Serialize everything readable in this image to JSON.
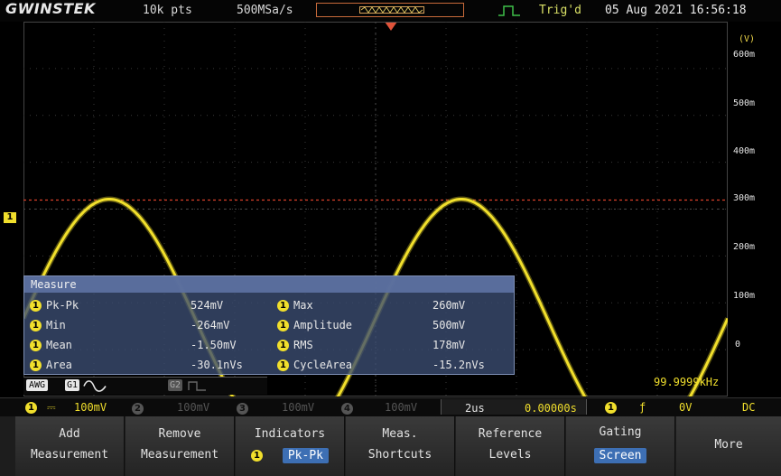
{
  "topbar": {
    "logo": "GWINSTEK",
    "record_length": "10k pts",
    "sample_rate": "500MSa/s",
    "trigger_status": "Trig'd",
    "datetime": "05 Aug 2021 16:56:18"
  },
  "right_scale": {
    "unit": "(V)",
    "labels": [
      "600m",
      "500m",
      "400m",
      "300m",
      "200m",
      "100m",
      "0"
    ]
  },
  "markers": {
    "channel": "1"
  },
  "measure": {
    "title": "Measure",
    "rows": [
      {
        "name": "Pk-Pk",
        "value": "524mV",
        "name2": "Max",
        "value2": "260mV"
      },
      {
        "name": "Min",
        "value": "-264mV",
        "name2": "Amplitude",
        "value2": "500mV"
      },
      {
        "name": "Mean",
        "value": "-1.50mV",
        "name2": "RMS",
        "value2": "178mV"
      },
      {
        "name": "Area",
        "value": "-30.1nVs",
        "name2": "CycleArea",
        "value2": "-15.2nVs"
      }
    ]
  },
  "frequency": "99.9999kHz",
  "source_bar": {
    "awg": "AWG",
    "g1": "G1",
    "g2": "G2"
  },
  "channel_bar": {
    "ch1": "1",
    "ch1_scale": "100mV",
    "ch2": "2",
    "ch2_scale": "100mV",
    "ch3": "3",
    "ch3_scale": "100mV",
    "ch4": "4",
    "ch4_scale": "100mV",
    "timebase": "2us",
    "delay": "0.00000s",
    "trig_source": "1",
    "trig_level": "0V",
    "coupling": "DC"
  },
  "menu": {
    "add": [
      "Add",
      "Measurement"
    ],
    "remove": [
      "Remove",
      "Measurement"
    ],
    "indicators": [
      "Indicators",
      "Pk-Pk"
    ],
    "indicators_badge": "1",
    "meas_shortcuts": [
      "Meas.",
      "Shortcuts"
    ],
    "ref_levels": [
      "Reference",
      "Levels"
    ],
    "gating": [
      "Gating",
      "Screen"
    ],
    "more": "More"
  },
  "colors": {
    "trace": "#f1df2c",
    "cursor": "#d8402a",
    "highlight": "#3d6fb4"
  },
  "waveform": {
    "period_us": 10,
    "amplitude_mV": 262,
    "offset_mV": 0
  }
}
